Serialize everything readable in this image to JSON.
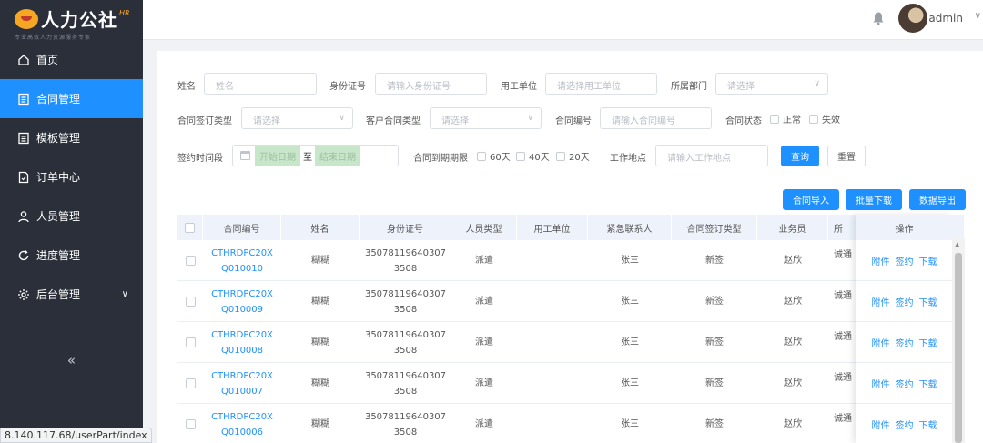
{
  "brand": {
    "name": "人力公社",
    "badge": "HR",
    "slogan": "专业高效人力资源服务专家"
  },
  "sidebar": {
    "items": [
      {
        "label": "首页",
        "icon": "home-icon"
      },
      {
        "label": "合同管理",
        "icon": "contract-icon",
        "active": true
      },
      {
        "label": "模板管理",
        "icon": "template-icon"
      },
      {
        "label": "订单中心",
        "icon": "order-icon"
      },
      {
        "label": "人员管理",
        "icon": "person-icon"
      },
      {
        "label": "进度管理",
        "icon": "refresh-icon"
      },
      {
        "label": "后台管理",
        "icon": "gear-icon",
        "expandable": true
      }
    ],
    "collapse_glyph": "«"
  },
  "header": {
    "username": "admin",
    "caret": "∨"
  },
  "status_url": "8.140.117.68/userPart/index",
  "filters": {
    "name": {
      "label": "姓名",
      "placeholder": "姓名"
    },
    "id_card": {
      "label": "身份证号",
      "placeholder": "请输入身份证号"
    },
    "employer": {
      "label": "用工单位",
      "placeholder": "请选择用工单位"
    },
    "department": {
      "label": "所属部门",
      "placeholder": "请选择"
    },
    "sign_type": {
      "label": "合同签订类型",
      "placeholder": "请选择"
    },
    "customer_contract_type": {
      "label": "客户合同类型",
      "placeholder": "请选择"
    },
    "contract_no": {
      "label": "合同编号",
      "placeholder": "请输入合同编号"
    },
    "contract_status": {
      "label": "合同状态",
      "options": [
        "正常",
        "失效"
      ]
    },
    "sign_time": {
      "label": "签约时间段",
      "start": "开始日期",
      "sep": "至",
      "end": "结束日期"
    },
    "expiry": {
      "label": "合同到期期限",
      "options": [
        "60天",
        "40天",
        "20天"
      ]
    },
    "work_location": {
      "label": "工作地点",
      "placeholder": "请输入工作地点"
    },
    "query_button": "查询",
    "reset_button": "重置"
  },
  "actions": {
    "import": "合同导入",
    "batch_download": "批量下载",
    "export": "数据导出"
  },
  "table": {
    "columns": [
      "合同编号",
      "姓名",
      "身份证号",
      "人员类型",
      "用工单位",
      "紧急联系人",
      "合同签订类型",
      "业务员",
      "所",
      "操作"
    ],
    "rows": [
      {
        "no1": "CTHRDPC20X",
        "no2": "Q010010",
        "name": "糊糊",
        "id1": "35078119640307",
        "id2": "3508",
        "type": "派遣",
        "employer": "",
        "contact": "张三",
        "sign": "新签",
        "agent": "赵欣",
        "loc": "诚通"
      },
      {
        "no1": "CTHRDPC20X",
        "no2": "Q010009",
        "name": "糊糊",
        "id1": "35078119640307",
        "id2": "3508",
        "type": "派遣",
        "employer": "",
        "contact": "张三",
        "sign": "新签",
        "agent": "赵欣",
        "loc": "诚通"
      },
      {
        "no1": "CTHRDPC20X",
        "no2": "Q010008",
        "name": "糊糊",
        "id1": "35078119640307",
        "id2": "3508",
        "type": "派遣",
        "employer": "",
        "contact": "张三",
        "sign": "新签",
        "agent": "赵欣",
        "loc": "诚通"
      },
      {
        "no1": "CTHRDPC20X",
        "no2": "Q010007",
        "name": "糊糊",
        "id1": "35078119640307",
        "id2": "3508",
        "type": "派遣",
        "employer": "",
        "contact": "张三",
        "sign": "新签",
        "agent": "赵欣",
        "loc": "诚通"
      },
      {
        "no1": "CTHRDPC20X",
        "no2": "Q010006",
        "name": "糊糊",
        "id1": "35078119640307",
        "id2": "3508",
        "type": "派遣",
        "employer": "",
        "contact": "张三",
        "sign": "新签",
        "agent": "赵欣",
        "loc": "诚通"
      }
    ],
    "ops": {
      "attach": "附件",
      "sign": "签约",
      "download": "下载"
    }
  },
  "colors": {
    "primary": "#1e90ff",
    "sidebar_bg": "#2b2f3a",
    "header_row_bg": "#eef3fb"
  }
}
